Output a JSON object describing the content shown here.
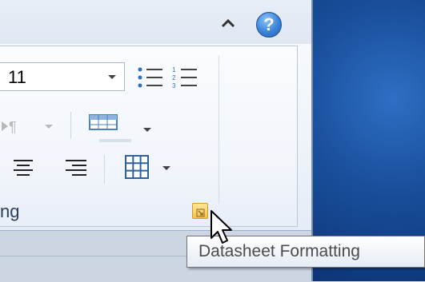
{
  "font_size": {
    "value": "11"
  },
  "groups": {
    "label": "ng"
  },
  "buttons": {
    "help_label": "?"
  },
  "tooltip": {
    "text": "Datasheet Formatting"
  }
}
